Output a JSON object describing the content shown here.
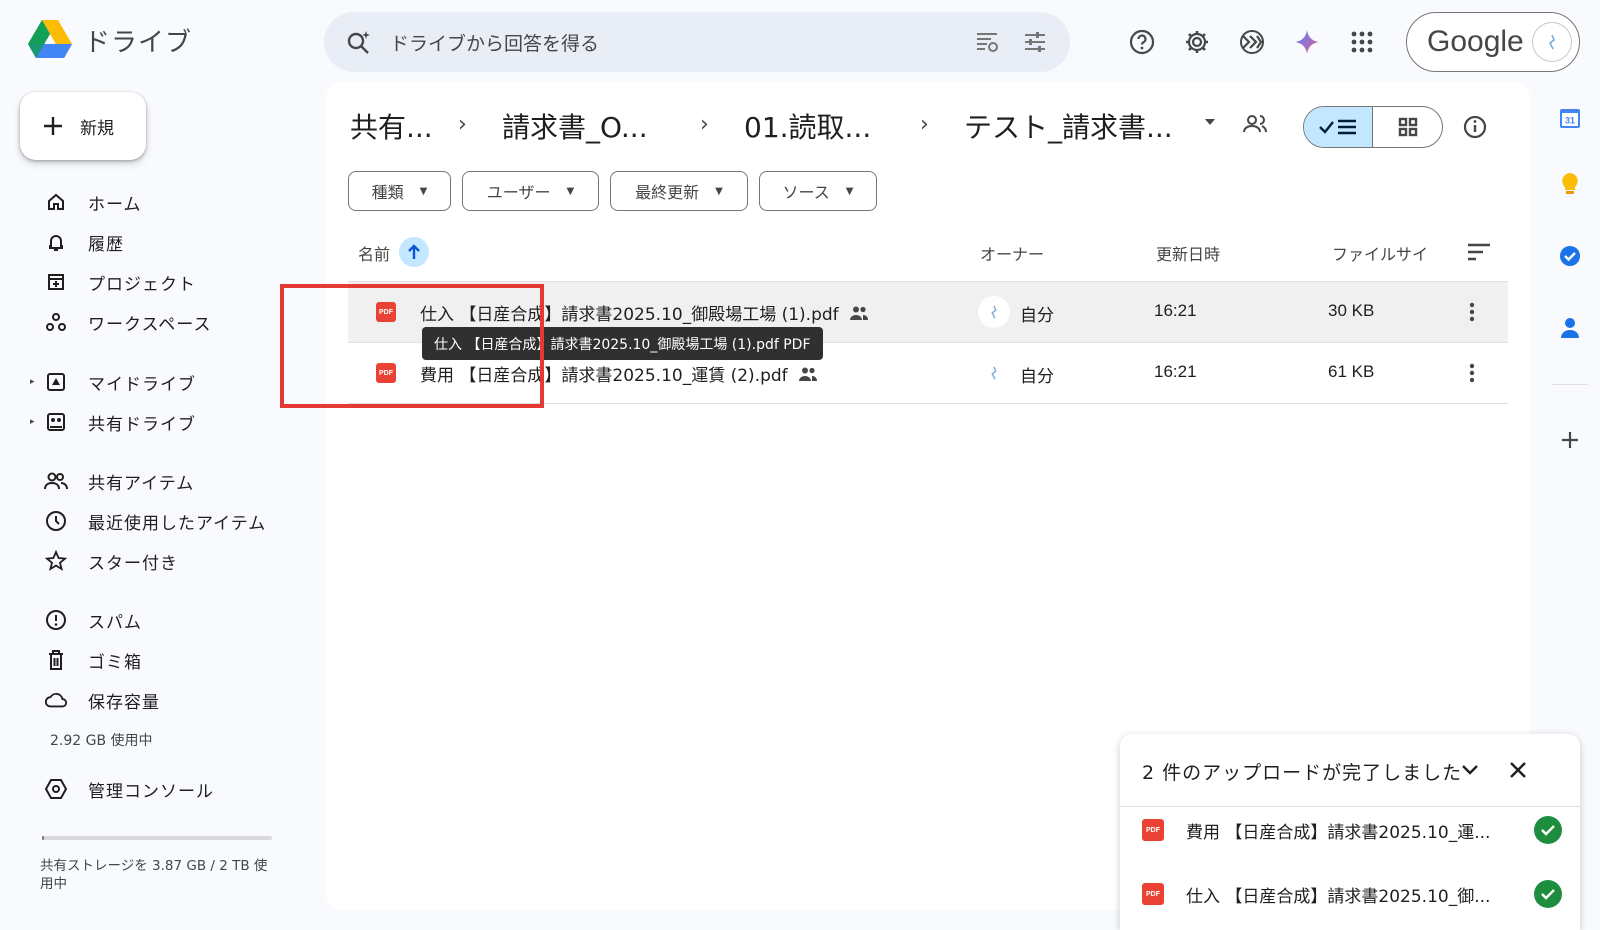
{
  "app": {
    "title": "ドライブ"
  },
  "search": {
    "placeholder": "ドライブから回答を得る"
  },
  "account": {
    "label": "Google"
  },
  "nav": {
    "new_label": "新規",
    "items": [
      {
        "label": "ホーム"
      },
      {
        "label": "履歴"
      },
      {
        "label": "プロジェクト"
      },
      {
        "label": "ワークスペース"
      },
      {
        "label": "マイドライブ"
      },
      {
        "label": "共有ドライブ"
      },
      {
        "label": "共有アイテム"
      },
      {
        "label": "最近使用したアイテム"
      },
      {
        "label": "スター付き"
      },
      {
        "label": "スパム"
      },
      {
        "label": "ゴミ箱"
      },
      {
        "label": "保存容量"
      },
      {
        "label": "管理コンソール"
      }
    ],
    "storage_used": "2.92 GB 使用中",
    "shared_storage": "共有ストレージを 3.87 GB / 2 TB 使用中",
    "shared_storage_fraction": 0.002
  },
  "breadcrumb": [
    "共有...",
    "請求書_O...",
    "01.読取...",
    "テスト_請求書..."
  ],
  "filters": [
    "種類",
    "ユーザー",
    "最終更新",
    "ソース"
  ],
  "columns": {
    "name": "名前",
    "owner": "オーナー",
    "modified": "更新日時",
    "size": "ファイルサイ"
  },
  "files": [
    {
      "name": "仕入 【日産合成】請求書2025.10_御殿場工場 (1).pdf",
      "owner": "自分",
      "modified": "16:21",
      "size": "30 KB",
      "type": "PDF"
    },
    {
      "name": "費用 【日産合成】請求書2025.10_運賃 (2).pdf",
      "owner": "自分",
      "modified": "16:21",
      "size": "61 KB",
      "type": "PDF"
    }
  ],
  "tooltip": "仕入 【日産合成】請求書2025.10_御殿場工場 (1).pdf PDF",
  "upload": {
    "title": "2 件のアップロードが完了しました",
    "items": [
      {
        "name": "費用 【日産合成】請求書2025.10_運..."
      },
      {
        "name": "仕入 【日産合成】請求書2025.10_御..."
      }
    ]
  },
  "side_panel": {
    "calendar_day": "31"
  },
  "icons": {
    "search": "search-spark-icon",
    "help": "help-icon",
    "settings": "gear-icon",
    "gemini": "gemini-icon",
    "apps": "apps-grid-icon"
  },
  "colors": {
    "accent": "#c2e7ff",
    "highlight": "#e53935",
    "pdf": "#ea4335",
    "check": "#1e8e3e"
  }
}
